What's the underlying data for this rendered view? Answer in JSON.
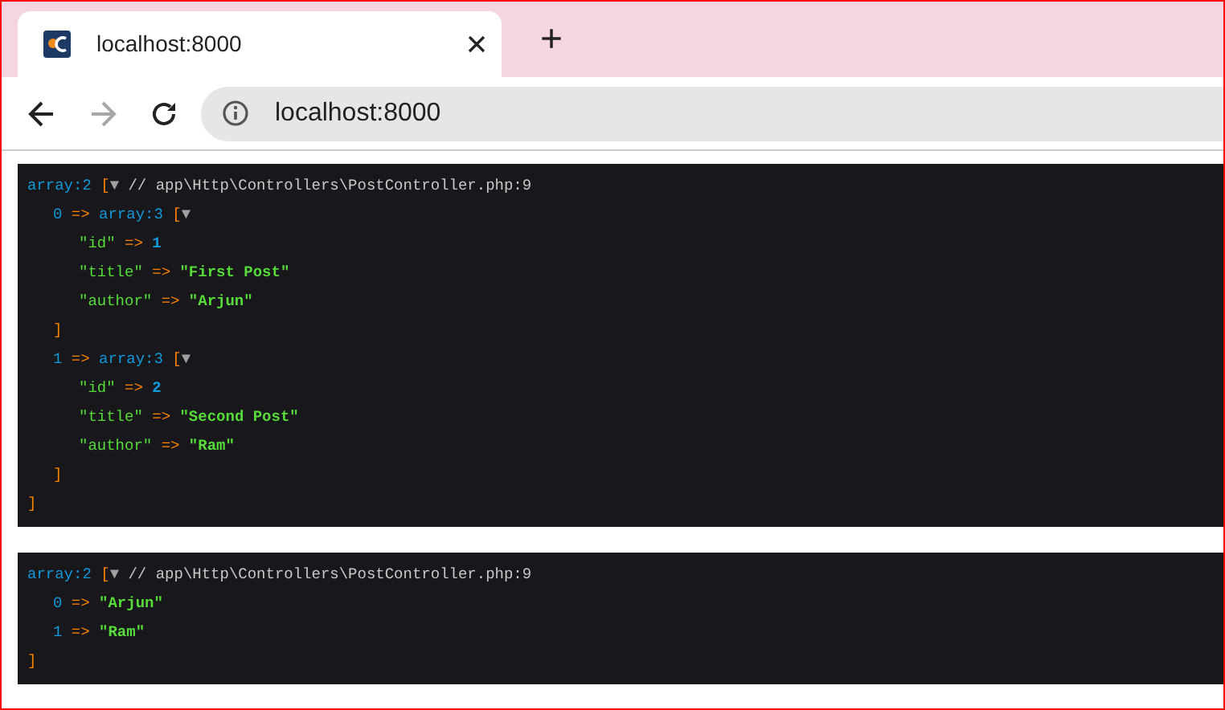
{
  "browser": {
    "tab": {
      "title": "localhost:8000",
      "selected": true
    },
    "new_tab": "+",
    "address": "localhost:8000",
    "forward_disabled": true
  },
  "dumps": [
    {
      "kind": "array",
      "type": "array:2",
      "open": "[",
      "toggle": "▼",
      "comment": "// app\\Http\\Controllers\\PostController.php:9",
      "close": "]",
      "entries": [
        {
          "kind": "array",
          "key": "0",
          "arrow": "=>",
          "type": "array:3",
          "open": "[",
          "toggle": "▼",
          "close": "]",
          "entries": [
            {
              "kind": "number",
              "key": "\"id\"",
              "arrow": "=>",
              "value": "1"
            },
            {
              "kind": "string",
              "key": "\"title\"",
              "arrow": "=>",
              "value": "\"First Post\""
            },
            {
              "kind": "string",
              "key": "\"author\"",
              "arrow": "=>",
              "value": "\"Arjun\""
            }
          ]
        },
        {
          "kind": "array",
          "key": "1",
          "arrow": "=>",
          "type": "array:3",
          "open": "[",
          "toggle": "▼",
          "close": "]",
          "entries": [
            {
              "kind": "number",
              "key": "\"id\"",
              "arrow": "=>",
              "value": "2"
            },
            {
              "kind": "string",
              "key": "\"title\"",
              "arrow": "=>",
              "value": "\"Second Post\""
            },
            {
              "kind": "string",
              "key": "\"author\"",
              "arrow": "=>",
              "value": "\"Ram\""
            }
          ]
        }
      ]
    },
    {
      "kind": "array",
      "type": "array:2",
      "open": "[",
      "toggle": "▼",
      "comment": "// app\\Http\\Controllers\\PostController.php:9",
      "close": "]",
      "entries": [
        {
          "kind": "string",
          "key": "0",
          "arrow": "=>",
          "value": "\"Arjun\""
        },
        {
          "kind": "string",
          "key": "1",
          "arrow": "=>",
          "value": "\"Ram\""
        }
      ]
    }
  ]
}
